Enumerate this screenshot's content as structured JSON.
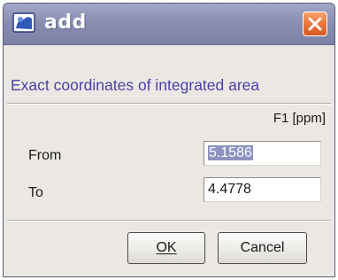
{
  "dialog": {
    "title": "add",
    "heading": "Exact coordinates of integrated area",
    "column_header": "F1 [ppm]",
    "rows": [
      {
        "label": "From",
        "value": "5.1586",
        "selected": true
      },
      {
        "label": "To",
        "value": "4.4778",
        "selected": false
      }
    ],
    "buttons": {
      "ok": "OK",
      "cancel": "Cancel"
    }
  },
  "icons": {
    "app": "app-window-icon",
    "close": "close-icon"
  },
  "colors": {
    "titlebar": "#8a8fb3",
    "heading_text": "#4b3fa6",
    "close_button": "#e8733a",
    "selection": "#8d93c0"
  }
}
